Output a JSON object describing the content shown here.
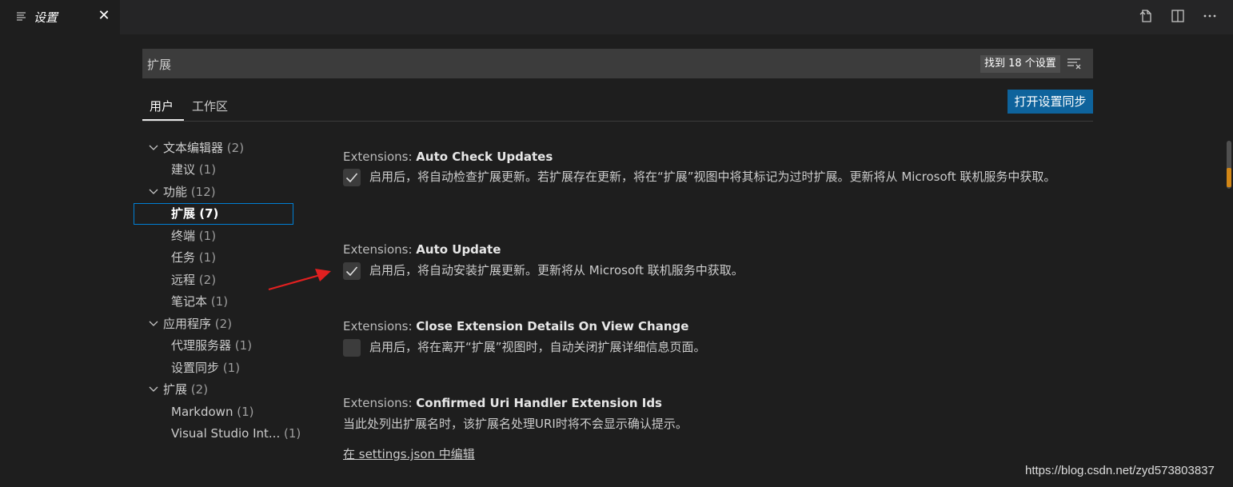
{
  "tab": {
    "title": "设置",
    "icons": [
      "settings-list-icon",
      "close-icon"
    ]
  },
  "toolbar": {
    "icons": [
      "open-json-icon",
      "split-editor-icon",
      "more-actions-icon"
    ]
  },
  "search": {
    "value": "扩展",
    "result_count": "找到 18 个设置",
    "filter_icon": "filter-icon"
  },
  "scope_tabs": [
    {
      "label": "用户",
      "active": true
    },
    {
      "label": "工作区",
      "active": false
    }
  ],
  "sync_button": {
    "label": "打开设置同步"
  },
  "toc": [
    {
      "label": "文本编辑器",
      "count": "(2)",
      "level": 0,
      "expanded": true
    },
    {
      "label": "建议",
      "count": "(1)",
      "level": 1
    },
    {
      "label": "功能",
      "count": "(12)",
      "level": 0,
      "expanded": true
    },
    {
      "label": "扩展",
      "count": "(7)",
      "level": 1,
      "selected": true
    },
    {
      "label": "终端",
      "count": "(1)",
      "level": 1
    },
    {
      "label": "任务",
      "count": "(1)",
      "level": 1
    },
    {
      "label": "远程",
      "count": "(2)",
      "level": 1
    },
    {
      "label": "笔记本",
      "count": "(1)",
      "level": 1
    },
    {
      "label": "应用程序",
      "count": "(2)",
      "level": 0,
      "expanded": true
    },
    {
      "label": "代理服务器",
      "count": "(1)",
      "level": 1
    },
    {
      "label": "设置同步",
      "count": "(1)",
      "level": 1
    },
    {
      "label": "扩展",
      "count": "(2)",
      "level": 0,
      "expanded": true
    },
    {
      "label": "Markdown",
      "count": "(1)",
      "level": 1
    },
    {
      "label": "Visual Studio Int...",
      "count": "(1)",
      "level": 1
    }
  ],
  "settings": [
    {
      "category": "Extensions: ",
      "name": "Auto Check Updates",
      "checked": true,
      "description": "启用后，将自动检查扩展更新。若扩展存在更新，将在“扩展”视图中将其标记为过时扩展。更新将从 Microsoft 联机服务中获取。"
    },
    {
      "category": "Extensions: ",
      "name": "Auto Update",
      "checked": true,
      "description": "启用后，将自动安装扩展更新。更新将从 Microsoft 联机服务中获取。"
    },
    {
      "category": "Extensions: ",
      "name": "Close Extension Details On View Change",
      "checked": false,
      "description": "启用后，将在离开“扩展”视图时，自动关闭扩展详细信息页面。"
    },
    {
      "category": "Extensions: ",
      "name": "Confirmed Uri Handler Extension Ids",
      "description": "当此处列出扩展名时，该扩展名处理URI时将不会显示确认提示。",
      "link": "在 settings.json 中编辑"
    }
  ],
  "watermark": "https://blog.csdn.net/zyd573803837",
  "colors": {
    "background": "#1e1e1e",
    "accent": "#0e639c",
    "focus_border": "#007fd4",
    "arrow": "#e02020",
    "scroll_mark": "#d18616"
  }
}
